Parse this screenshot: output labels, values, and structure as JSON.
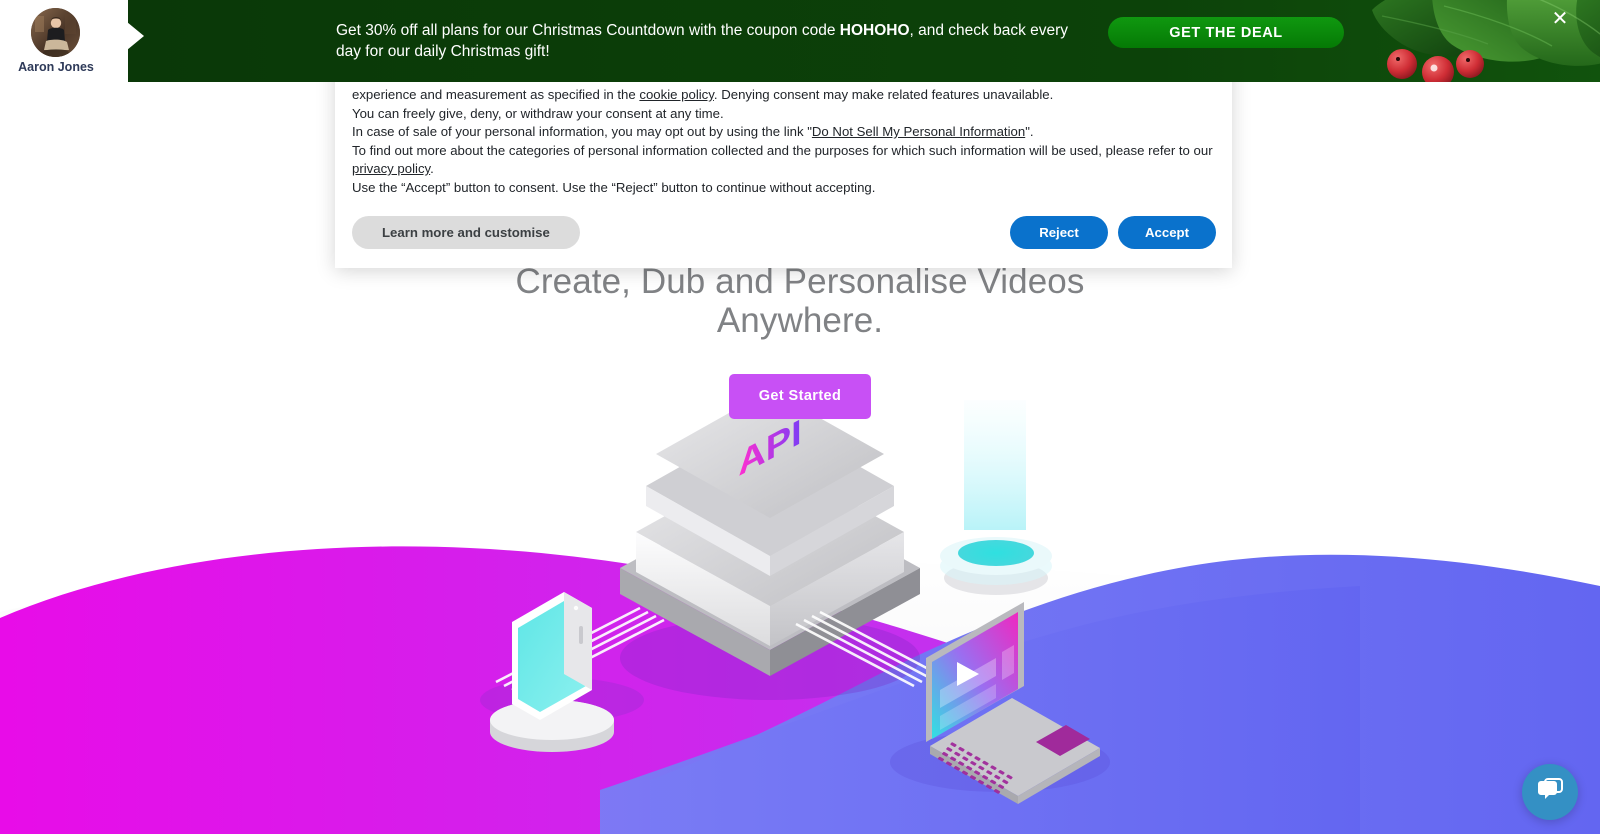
{
  "avatar": {
    "name": "Aaron Jones",
    "icon": "user-avatar-photo"
  },
  "promo_banner": {
    "text_part1": "Get 30% off all plans for our Christmas Countdown with the coupon code ",
    "coupon_code": "HOHOHO",
    "text_part2": ", and check back every day for our daily Christmas gift!",
    "cta_label": "GET THE DEAL",
    "close_icon": "✕",
    "bg_color": "#0a3808",
    "cta_color": "#0a8a0a",
    "decoration": "holly-leaves-and-berries"
  },
  "cookie_dialog": {
    "line1": "experience and measurement as specified in the ",
    "link_cookie": "cookie policy",
    "line1b": ". Denying consent may make related features unavailable.",
    "line2": "You can freely give, deny, or withdraw your consent at any time.",
    "line3a": "In case of sale of your personal information, you may opt out by using the link \"",
    "link_donotsell": "Do Not Sell My Personal Information",
    "line3b": "\".",
    "line4a": "To find out more about the categories of personal information collected and the purposes for which such information will be used, please refer to our ",
    "link_privacy": "privacy policy",
    "line4b": ".",
    "line5": "Use the “Accept” button to consent. Use the “Reject” button to continue without accepting.",
    "learn_more_label": "Learn more and customise",
    "reject_label": "Reject",
    "accept_label": "Accept",
    "accent_color": "#0a72cc"
  },
  "hero": {
    "title_line1": "Create, Dub and Personalise Videos",
    "title_line2": "Anywhere.",
    "cta_label": "Get Started",
    "cta_color": "#c850f5",
    "title_color": "#808285"
  },
  "illustration": {
    "server_label": "API",
    "elements": [
      "api-server-stack",
      "smartphone-on-pedestal",
      "hologram-projector-pad",
      "laptop-with-video-player",
      "connection-cables"
    ],
    "wave_left_color": "#e211ef",
    "wave_right_color": "#6f72f2"
  },
  "chat_widget": {
    "icon": "chat-bubbles-icon",
    "color": "#3490c4"
  }
}
